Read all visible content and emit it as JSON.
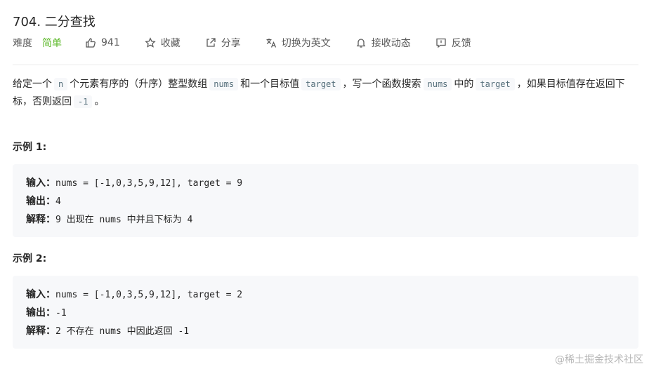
{
  "problem": {
    "title": "704. 二分查找"
  },
  "toolbar": {
    "difficulty_label": "难度",
    "difficulty_value": "简单",
    "difficulty_color": "#5ab726",
    "like_count": "941",
    "favorite_label": "收藏",
    "share_label": "分享",
    "translate_label": "切换为英文",
    "subscribe_label": "接收动态",
    "feedback_label": "反馈"
  },
  "description": {
    "p1": "给定一个",
    "code_n": "n",
    "p2": "个元素有序的（升序）整型数组",
    "code_nums": "nums",
    "p3": "和一个目标值",
    "code_target": "target",
    "p4": "，写一个函数搜索",
    "code_nums2": "nums",
    "p5": "中的",
    "code_target2": "target",
    "p6": "，如果目标值存在返回下标，否则返回",
    "code_neg1": "-1",
    "p7": "。"
  },
  "examples": [
    {
      "title": "示例 1:",
      "input_key": "输入：",
      "input_val": "nums = [-1,0,3,5,9,12], target = 9",
      "output_key": "输出：",
      "output_val": "4",
      "explain_key": "解释：",
      "explain_val": "9 出现在 nums 中并且下标为 4"
    },
    {
      "title": "示例 2:",
      "input_key": "输入：",
      "input_val": "nums = [-1,0,3,5,9,12], target = 2",
      "output_key": "输出：",
      "output_val": "-1",
      "explain_key": "解释：",
      "explain_val": "2 不存在 nums 中因此返回 -1"
    }
  ],
  "watermark": "@稀土掘金技术社区",
  "colors": {
    "code_bg": "#f7f8fa",
    "code_text": "#546e7a",
    "muted_text": "#595959"
  },
  "icons": [
    "thumbs-up-icon",
    "star-icon",
    "share-icon",
    "translate-icon",
    "bell-icon",
    "feedback-icon"
  ]
}
